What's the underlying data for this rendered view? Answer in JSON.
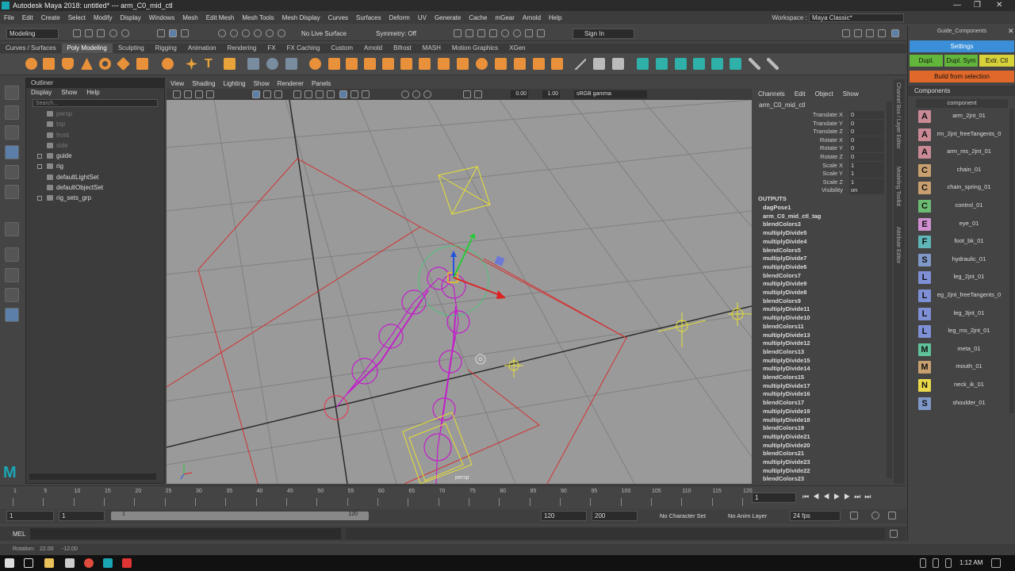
{
  "window": {
    "title": "Autodesk Maya 2018: untitled*   ---   arm_C0_mid_ctl"
  },
  "menubar": [
    "File",
    "Edit",
    "Create",
    "Select",
    "Modify",
    "Display",
    "Windows",
    "Mesh",
    "Edit Mesh",
    "Mesh Tools",
    "Mesh Display",
    "Curves",
    "Surfaces",
    "Deform",
    "UV",
    "Generate",
    "Cache",
    "mGear",
    "Arnold",
    "Help"
  ],
  "workspace": {
    "label": "Workspace :",
    "value": "Maya Classic*"
  },
  "statusline": {
    "mode": "Modeling",
    "live": "No Live Surface",
    "symmetry": "Symmetry: Off",
    "signin": "Sign In"
  },
  "shelf_tabs": [
    "Curves / Surfaces",
    "Poly Modeling",
    "Sculpting",
    "Rigging",
    "Animation",
    "Rendering",
    "FX",
    "FX Caching",
    "Custom",
    "Arnold",
    "Bifrost",
    "MASH",
    "Motion Graphics",
    "XGen"
  ],
  "shelf_active": "Poly Modeling",
  "outliner": {
    "title": "Outliner",
    "menu": [
      "Display",
      "Show",
      "Help"
    ],
    "search_placeholder": "Search...",
    "items": [
      {
        "label": "persp",
        "dim": true,
        "expand": false
      },
      {
        "label": "top",
        "dim": true,
        "expand": false
      },
      {
        "label": "front",
        "dim": true,
        "expand": false
      },
      {
        "label": "side",
        "dim": true,
        "expand": false
      },
      {
        "label": "guide",
        "dim": false,
        "expand": true
      },
      {
        "label": "rig",
        "dim": false,
        "expand": true
      },
      {
        "label": "defaultLightSet",
        "dim": false,
        "expand": false
      },
      {
        "label": "defaultObjectSet",
        "dim": false,
        "expand": false
      },
      {
        "label": "rig_sets_grp",
        "dim": false,
        "expand": true
      }
    ]
  },
  "viewport": {
    "menu": [
      "View",
      "Shading",
      "Lighting",
      "Show",
      "Renderer",
      "Panels"
    ],
    "field1": "0.00",
    "field2": "1.00",
    "colorspace": "sRGB gamma",
    "camera": "persp"
  },
  "channelbox": {
    "menu": [
      "Channels",
      "Edit",
      "Object",
      "Show"
    ],
    "object": "arm_C0_mid_ctl",
    "attrs": [
      {
        "name": "Translate X",
        "value": "0"
      },
      {
        "name": "Translate Y",
        "value": "0"
      },
      {
        "name": "Translate Z",
        "value": "0"
      },
      {
        "name": "Rotate X",
        "value": "0"
      },
      {
        "name": "Rotate Y",
        "value": "0"
      },
      {
        "name": "Rotate Z",
        "value": "0"
      },
      {
        "name": "Scale X",
        "value": "1"
      },
      {
        "name": "Scale Y",
        "value": "1"
      },
      {
        "name": "Scale Z",
        "value": "1"
      },
      {
        "name": "Visibility",
        "value": "on"
      }
    ],
    "outputs_label": "OUTPUTS",
    "outputs": [
      "dagPose1",
      "arm_C0_mid_ctl_tag",
      "blendColors3",
      "multiplyDivide5",
      "multiplyDivide4",
      "blendColors5",
      "multiplyDivide7",
      "multiplyDivide6",
      "blendColors7",
      "multiplyDivide9",
      "multiplyDivide8",
      "blendColors9",
      "multiplyDivide11",
      "multiplyDivide10",
      "blendColors11",
      "multiplyDivide13",
      "multiplyDivide12",
      "blendColors13",
      "multiplyDivide15",
      "multiplyDivide14",
      "blendColors15",
      "multiplyDivide17",
      "multiplyDivide16",
      "blendColors17",
      "multiplyDivide19",
      "multiplyDivide18",
      "blendColors19",
      "multiplyDivide21",
      "multiplyDivide20",
      "blendColors21",
      "multiplyDivide23",
      "multiplyDivide22",
      "blendColors23"
    ]
  },
  "side_tabs": [
    "Channel Box / Layer Editor",
    "Modeling Toolkit",
    "Attribute Editor"
  ],
  "guide": {
    "title": "Guide_Components",
    "settings": "Settings",
    "dupl": "Dupl.",
    "dupl_sym": "Dupl. Sym",
    "extr": "Extr. Ctl",
    "build": "Build from selection",
    "components_label": "Components",
    "component_header": "component",
    "components": [
      {
        "letter": "A",
        "label": "arm_2jnt_01",
        "color": "#c98a95"
      },
      {
        "letter": "A",
        "label": "rm_2jnt_freeTangents_0",
        "color": "#c98a95"
      },
      {
        "letter": "A",
        "label": "arm_ms_2jnt_01",
        "color": "#c98a95"
      },
      {
        "letter": "C",
        "label": "chain_01",
        "color": "#c8a070"
      },
      {
        "letter": "C",
        "label": "chain_spring_01",
        "color": "#c8a070"
      },
      {
        "letter": "C",
        "label": "control_01",
        "color": "#6dbb72"
      },
      {
        "letter": "E",
        "label": "eye_01",
        "color": "#cf8fd0"
      },
      {
        "letter": "F",
        "label": "foot_bk_01",
        "color": "#5fb5b8"
      },
      {
        "letter": "S",
        "label": "hydraulic_01",
        "color": "#7f98c8"
      },
      {
        "letter": "L",
        "label": "leg_2jnt_01",
        "color": "#7f8fd6"
      },
      {
        "letter": "L",
        "label": "eg_2jnt_freeTangents_0",
        "color": "#7f8fd6"
      },
      {
        "letter": "L",
        "label": "leg_3jnt_01",
        "color": "#7f8fd6"
      },
      {
        "letter": "L",
        "label": "leg_ms_2jnt_01",
        "color": "#7f8fd6"
      },
      {
        "letter": "M",
        "label": "meta_01",
        "color": "#5fc29a"
      },
      {
        "letter": "M",
        "label": "mouth_01",
        "color": "#c8a070"
      },
      {
        "letter": "N",
        "label": "neck_ik_01",
        "color": "#e8d84a"
      },
      {
        "letter": "S",
        "label": "shoulder_01",
        "color": "#7f98c8"
      }
    ]
  },
  "timeline": {
    "ticks": [
      "1",
      "5",
      "10",
      "15",
      "20",
      "25",
      "30",
      "35",
      "40",
      "45",
      "50",
      "55",
      "60",
      "65",
      "70",
      "75",
      "80",
      "85",
      "90",
      "95",
      "100",
      "105",
      "110",
      "115",
      "120"
    ],
    "current": "1"
  },
  "range": {
    "start": "1",
    "inner_start": "1",
    "slider_start": "1",
    "slider_end": "120",
    "end": "120",
    "outer_end": "200",
    "character": "No Character Set",
    "anim_layer": "No Anim Layer",
    "fps": "24 fps"
  },
  "mel": {
    "label": "MEL"
  },
  "helpline": {
    "label": "Rotation:",
    "v1": "22.00",
    "v2": "-12.00"
  },
  "taskbar": {
    "time": "1:12 AM"
  }
}
